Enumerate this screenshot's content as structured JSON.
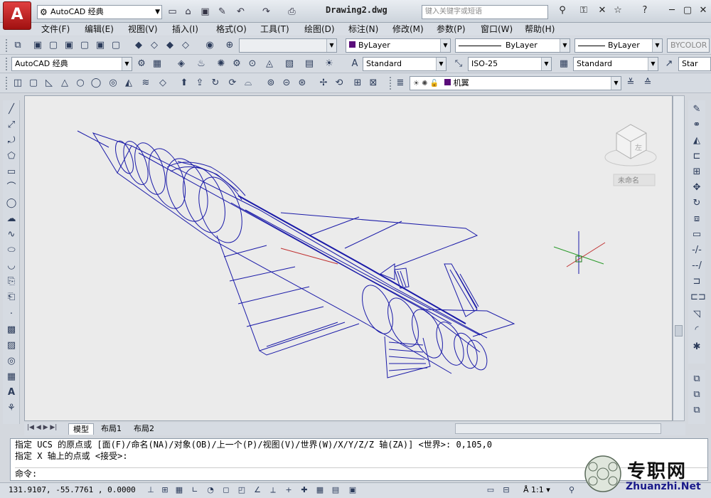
{
  "app": {
    "workspace": "AutoCAD 经典",
    "document_title": "Drawing2.dwg",
    "search_placeholder": "键入关键字或短语"
  },
  "menu": [
    "文件(F)",
    "编辑(E)",
    "视图(V)",
    "插入(I)",
    "格式(O)",
    "工具(T)",
    "绘图(D)",
    "标注(N)",
    "修改(M)",
    "参数(P)",
    "窗口(W)",
    "帮助(H)"
  ],
  "properties": {
    "color": "ByLayer",
    "linetype": "ByLayer",
    "lineweight": "ByLayer",
    "plotstyle": "BYCOLOR"
  },
  "styles": {
    "workspace2": "AutoCAD 经典",
    "text_style": "Standard",
    "dim_style": "ISO-25",
    "table_style": "Standard",
    "multileader_style": "Star"
  },
  "layer": {
    "name": "机翼",
    "color": "#5a0d7a"
  },
  "viewcube": {
    "face": "左",
    "wcs": "未命名"
  },
  "tabs": [
    "模型",
    "布局1",
    "布局2"
  ],
  "command_history": [
    "指定 UCS 的原点或 [面(F)/命名(NA)/对象(OB)/上一个(P)/视图(V)/世界(W)/X/Y/Z/Z 轴(ZA)] <世界>: 0,105,0",
    "指定 X 轴上的点或 <接受>:"
  ],
  "command_prompt": "命令:",
  "status": {
    "coords": "131.9107,  -55.7761 , 0.0000",
    "annotation_scale": "1:1"
  },
  "watermark": {
    "name": "专职网",
    "url": "Zhuanzhi.Net"
  },
  "colors": {
    "wire": "#1a1aa8",
    "accent_red": "#c03030"
  }
}
